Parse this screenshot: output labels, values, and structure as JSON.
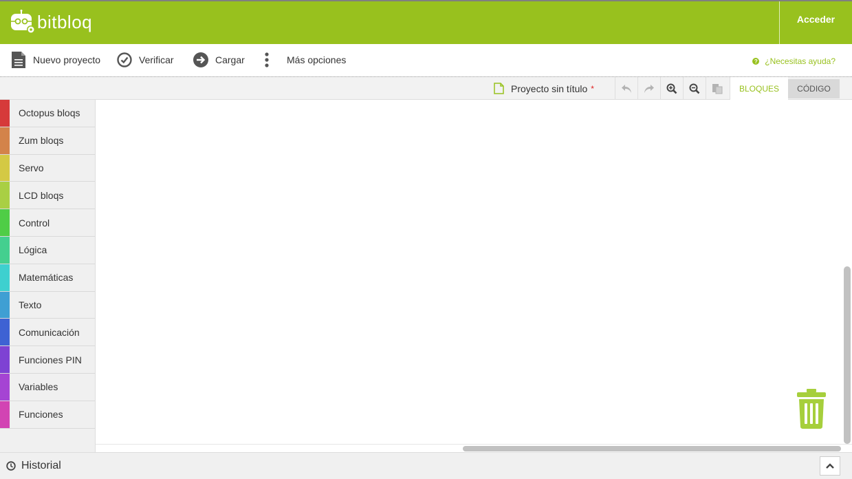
{
  "app": {
    "name": "bitbloq",
    "login_label": "Acceder"
  },
  "toolbar": {
    "new_project": "Nuevo proyecto",
    "verify": "Verificar",
    "upload": "Cargar",
    "more_options": "Más opciones",
    "help": "¿Necesitas ayuda?"
  },
  "tabsbar": {
    "project_title": "Proyecto sin título",
    "unsaved_marker": "*",
    "tab_blocks": "BLOQUES",
    "tab_code": "CÓDIGO",
    "icons": [
      "undo-icon",
      "redo-icon",
      "zoom-in-icon",
      "zoom-out-icon",
      "paste-icon"
    ]
  },
  "sidebar": {
    "items": [
      {
        "label": "Octopus bloqs",
        "color": "#d63a3a"
      },
      {
        "label": "Zum bloqs",
        "color": "#d3834a"
      },
      {
        "label": "Servo",
        "color": "#d4c944"
      },
      {
        "label": "LCD bloqs",
        "color": "#a9cf44"
      },
      {
        "label": "Control",
        "color": "#4fcd46"
      },
      {
        "label": "Lógica",
        "color": "#44cf8f"
      },
      {
        "label": "Matemáticas",
        "color": "#3ed0cf"
      },
      {
        "label": "Texto",
        "color": "#3f9fd3"
      },
      {
        "label": "Comunicación",
        "color": "#3e62d3"
      },
      {
        "label": "Funciones PIN",
        "color": "#7e42d3"
      },
      {
        "label": "Variables",
        "color": "#a544d3"
      },
      {
        "label": "Funciones",
        "color": "#d244b3"
      }
    ]
  },
  "bottombar": {
    "history_label": "Historial"
  },
  "colors": {
    "brand": "#98c11e"
  }
}
